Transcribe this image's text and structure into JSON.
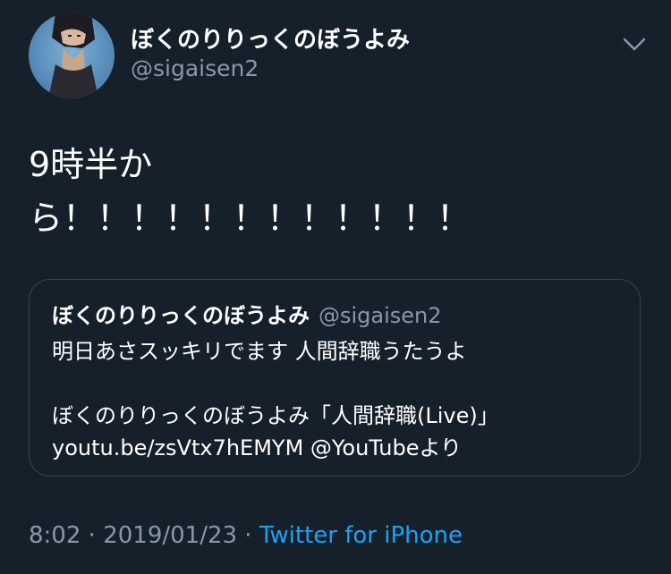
{
  "tweet": {
    "author": {
      "name": "ぼくのりりっくのぼうよみ",
      "handle": "@sigaisen2"
    },
    "text_line1": "9時半か",
    "text_line2": "ら！！！！！！！！！！！！",
    "quote": {
      "name": "ぼくのりりっくのぼうよみ",
      "handle": "@sigaisen2",
      "line1": "明日あさスッキリでます 人間辞職うたうよ",
      "line2": "",
      "line3": "ぼくのりりっくのぼうよみ「人間辞職(Live)」",
      "line4": "youtu.be/zsVtx7hEMYM @YouTubeより"
    },
    "time": "8:02",
    "separator": " · ",
    "date": "2019/01/23",
    "source": "Twitter for iPhone"
  },
  "colors": {
    "background": "#15202b",
    "text": "#ffffff",
    "secondary": "#8899a6",
    "link": "#1da1f2",
    "border": "#38444d"
  },
  "icons": {
    "more": "chevron-down-icon"
  }
}
